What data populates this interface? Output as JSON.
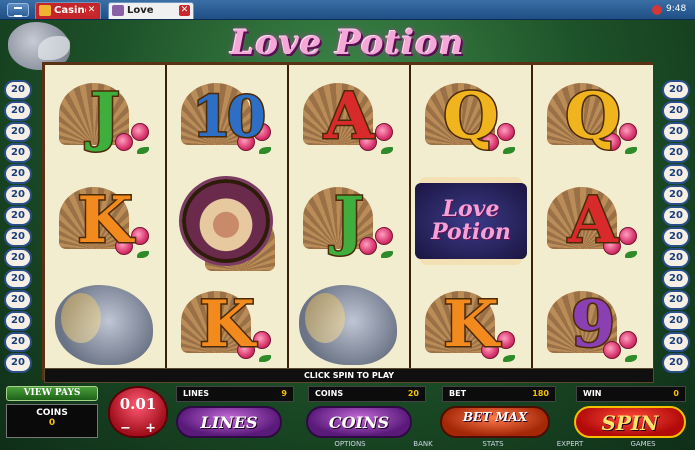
{
  "tabs": [
    {
      "label": "Casino",
      "close": "✕"
    },
    {
      "label": "Love Potion",
      "close": "✕"
    }
  ],
  "clock": "9:48",
  "game": {
    "title": "Love Potion",
    "logo_symbol_text": "Love Potion",
    "reels": [
      [
        "J",
        "K",
        "cupid-statue"
      ],
      [
        "10",
        "lady-portrait",
        "K"
      ],
      [
        "A",
        "J",
        "cupid-statue"
      ],
      [
        "Q",
        "love-potion-logo",
        "K"
      ],
      [
        "Q",
        "A",
        "9"
      ]
    ],
    "paylines_left": [
      "20",
      "20",
      "20",
      "20",
      "20",
      "20",
      "20",
      "20",
      "20",
      "20",
      "20",
      "20",
      "20",
      "20"
    ],
    "paylines_right": [
      "20",
      "20",
      "20",
      "20",
      "20",
      "20",
      "20",
      "20",
      "20",
      "20",
      "20",
      "20",
      "20",
      "20"
    ],
    "message": "CLICK SPIN TO PLAY"
  },
  "controls": {
    "view_pays": "VIEW PAYS",
    "coins_label": "COINS",
    "coins_value": "0",
    "denomination": "0.01",
    "denom_minus": "−",
    "denom_plus": "+",
    "lines_label": "LINES",
    "lines_value": "9",
    "coins_bet_label": "COINS",
    "coins_bet_value": "20",
    "bet_label": "BET",
    "bet_value": "180",
    "win_label": "WIN",
    "win_value": "0",
    "btn_lines": "LINES",
    "btn_coins": "COINS",
    "btn_betmax": "BET MAX",
    "btn_spin": "SPIN"
  },
  "menu": [
    "OPTIONS",
    "BANK",
    "STATS",
    "EXPERT",
    "GAMES"
  ]
}
